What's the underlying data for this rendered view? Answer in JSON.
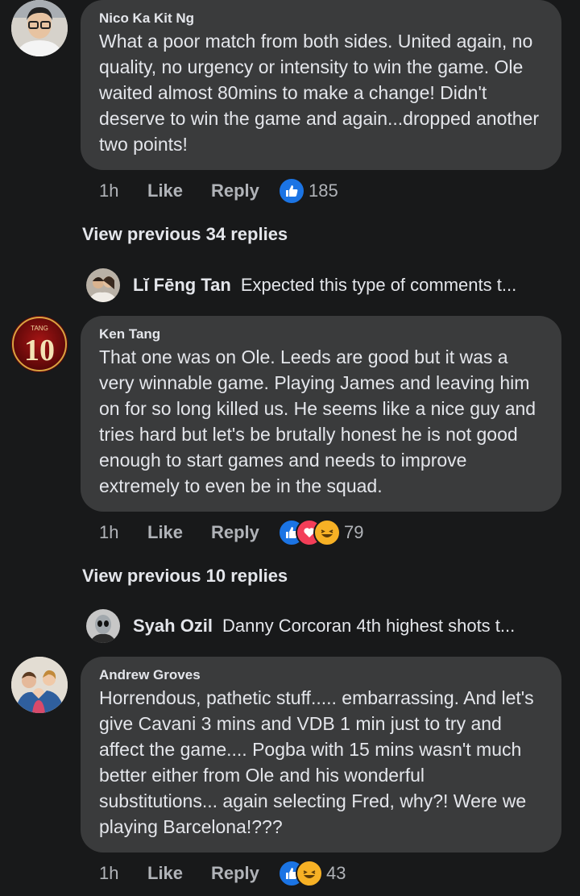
{
  "comments": [
    {
      "author": "Nico Ka Kit Ng",
      "text": "What a poor match from both sides. United again, no quality, no urgency or intensity to win the game. Ole waited almost 80mins to make a change! Didn't deserve to win the game and again...dropped another two points!",
      "time": "1h",
      "like_label": "Like",
      "reply_label": "Reply",
      "reaction_count": "185",
      "reactions": [
        "like-icon"
      ],
      "view_previous": "View previous 34 replies",
      "reply_preview": {
        "name": "Lĭ Fēng Tan",
        "text": "Expected this type of comments t..."
      }
    },
    {
      "author": "Ken Tang",
      "avatar_text": "10",
      "avatar_tag": "TANG",
      "text": "That one was on Ole. Leeds are good but it was a very winnable game. Playing James and leaving him on for so long killed us. He seems like a nice guy and tries hard but let's be brutally honest he is not good enough to start games and needs to improve extremely to even be in the squad.",
      "time": "1h",
      "like_label": "Like",
      "reply_label": "Reply",
      "reaction_count": "79",
      "reactions": [
        "like-icon",
        "love-icon",
        "haha-icon"
      ],
      "view_previous": "View previous 10 replies",
      "reply_preview": {
        "name": "Syah Ozil",
        "text": "Danny Corcoran 4th highest shots t..."
      }
    },
    {
      "author": "Andrew Groves",
      "text": "Horrendous, pathetic stuff..... embarrassing. And let's give Cavani 3 mins and VDB 1 min just to try and affect the game.... Pogba with 15 mins wasn't much better either from Ole and his wonderful substitutions... again selecting Fred, why?! Were we playing Barcelona!???",
      "time": "1h",
      "like_label": "Like",
      "reply_label": "Reply",
      "reaction_count": "43",
      "reactions": [
        "like-icon",
        "haha-icon"
      ]
    }
  ],
  "colors": {
    "background": "#18191a",
    "bubble": "#3a3b3c",
    "text": "#e4e6eb",
    "secondary_text": "#b0b3b8",
    "like_blue": "#1b74e4",
    "love_red": "#f33e58",
    "haha_yellow": "#f7b125"
  }
}
